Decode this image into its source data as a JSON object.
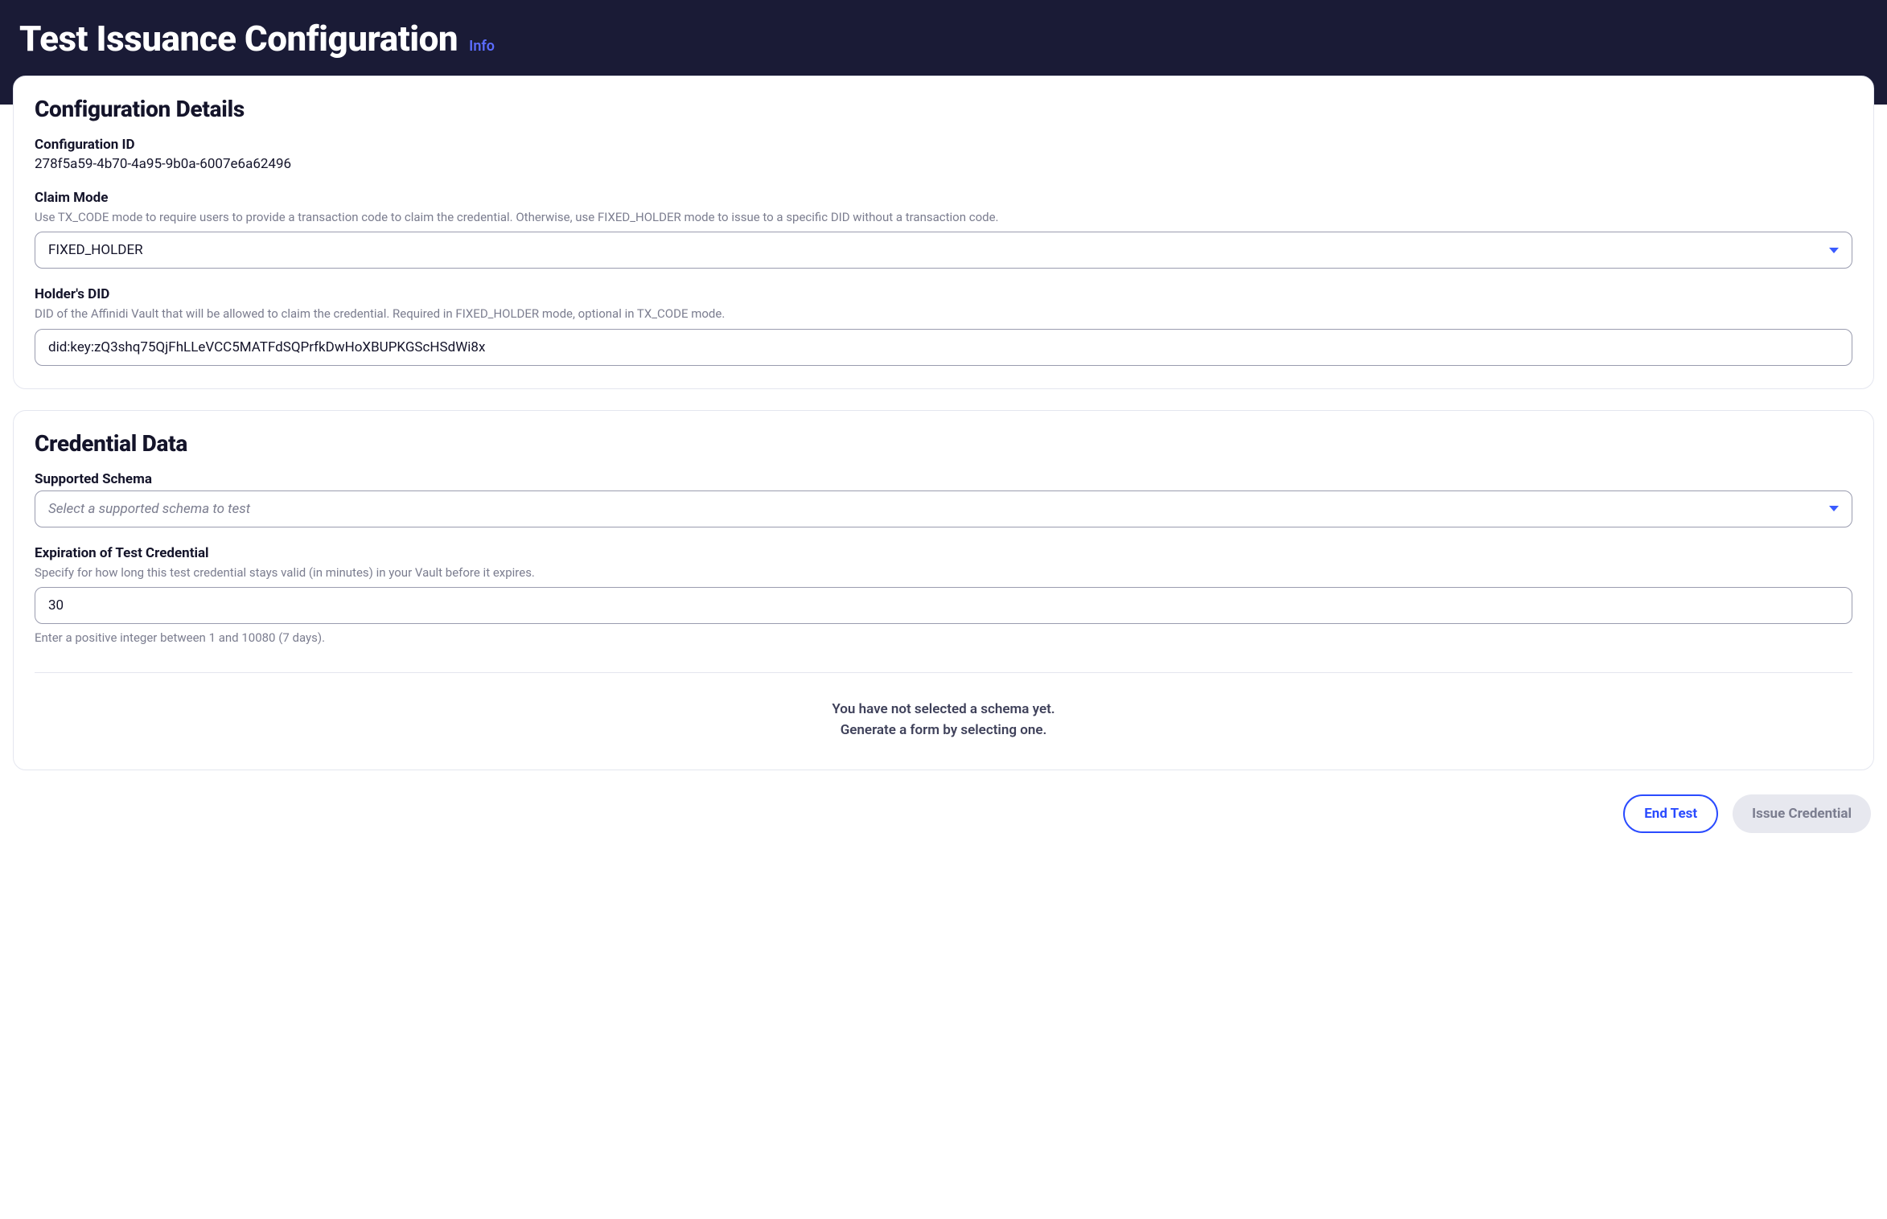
{
  "header": {
    "title": "Test Issuance Configuration",
    "info_label": "Info"
  },
  "config_details": {
    "heading": "Configuration Details",
    "config_id_label": "Configuration ID",
    "config_id_value": "278f5a59-4b70-4a95-9b0a-6007e6a62496",
    "claim_mode_label": "Claim Mode",
    "claim_mode_help": "Use TX_CODE mode to require users to provide a transaction code to claim the credential. Otherwise, use FIXED_HOLDER mode to issue to a specific DID without a transaction code.",
    "claim_mode_value": "FIXED_HOLDER",
    "holder_did_label": "Holder's DID",
    "holder_did_help": "DID of the Affinidi Vault that will be allowed to claim the credential. Required in FIXED_HOLDER mode, optional in TX_CODE mode.",
    "holder_did_value": "did:key:zQ3shq75QjFhLLeVCC5MATFdSQPrfkDwHoXBUPKGScHSdWi8x"
  },
  "credential_data": {
    "heading": "Credential Data",
    "schema_label": "Supported Schema",
    "schema_placeholder": "Select a supported schema to test",
    "expiration_label": "Expiration of Test Credential",
    "expiration_help": "Specify for how long this test credential stays valid (in minutes) in your Vault before it expires.",
    "expiration_value": "30",
    "expiration_hint": "Enter a positive integer between 1 and 10080 (7 days).",
    "empty_line1": "You have not selected a schema yet.",
    "empty_line2": "Generate a form by selecting one."
  },
  "footer": {
    "end_test_label": "End Test",
    "issue_label": "Issue Credential"
  }
}
